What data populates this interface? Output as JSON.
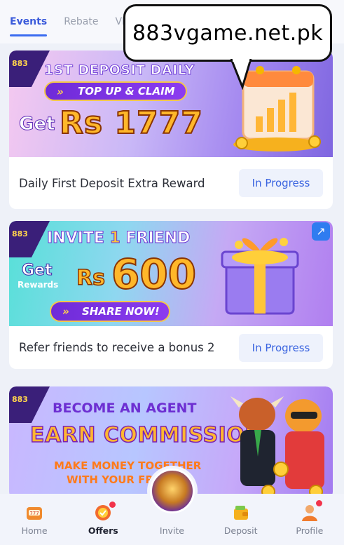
{
  "tabs": [
    {
      "label": "Events",
      "active": true
    },
    {
      "label": "Rebate",
      "active": false
    },
    {
      "label": "VIP",
      "active": false
    }
  ],
  "watermark": {
    "text": "883vgame.net.pk"
  },
  "cards": [
    {
      "banner": {
        "logo": "883",
        "headline": "1ST DEPOSIT DAILY",
        "pill": "TOP UP & CLAIM",
        "get": "Get",
        "amount": "Rs 1777"
      },
      "title": "Daily First Deposit Extra Reward",
      "status": "In Progress"
    },
    {
      "banner": {
        "logo": "883",
        "headline_pre": "INVITE",
        "headline_num": "1",
        "headline_post": "FRIEND",
        "get": "Get",
        "rewards": "Rewards",
        "rs": "Rs",
        "amount": "600",
        "pill": "SHARE NOW!"
      },
      "title": "Refer friends to receive a bonus 2",
      "status": "In Progress"
    },
    {
      "banner": {
        "logo": "883",
        "headline": "BECOME AN AGENT",
        "earn": "EARN COMMISSION",
        "sub1": "MAKE MONEY TOGETHER",
        "sub2": "WITH YOUR FRI"
      }
    }
  ],
  "bottom_nav": [
    {
      "label": "Home",
      "icon": "slot-machine-icon",
      "active": false
    },
    {
      "label": "Offers",
      "icon": "medal-icon",
      "active": true,
      "dot": true
    },
    {
      "label": "Invite",
      "icon": "treasure-chest-icon",
      "active": false
    },
    {
      "label": "Deposit",
      "icon": "wallet-icon",
      "active": false
    },
    {
      "label": "Profile",
      "icon": "user-icon",
      "active": false,
      "dot": true
    }
  ],
  "colors": {
    "accent": "#3b5bdb",
    "status_bg": "#eef2fc",
    "status_text": "#3a64e0",
    "badge": "#f2334b"
  }
}
